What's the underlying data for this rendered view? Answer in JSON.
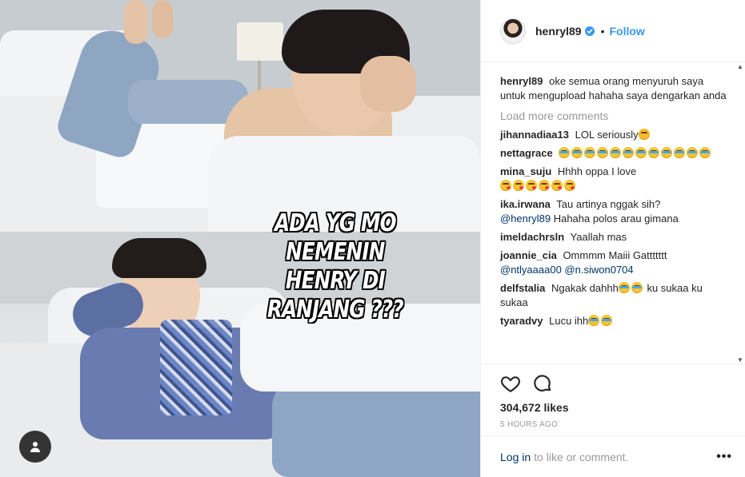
{
  "image": {
    "caption_line1": "ADA YG MO NEMENIN",
    "caption_line2": "HENRY DI RANJANG ???"
  },
  "header": {
    "username": "henryl89",
    "separator": "•",
    "follow_label": "Follow",
    "avatar_icon": "profile-avatar",
    "verified_icon": "verified-badge-icon",
    "accent_color": "#3897f0"
  },
  "caption": {
    "user": "henryl89",
    "text": "oke semua orang menyuruh saya untuk mengupload hahaha saya dengarkan anda"
  },
  "load_more": "Load more comments",
  "comments": [
    {
      "user": "jihannadiaa13",
      "text": "LOL seriously"
    },
    {
      "user": "nettagrace",
      "text": ""
    },
    {
      "user": "mina_suju",
      "text": "Hhhh oppa I love"
    },
    {
      "user": "ika.irwana",
      "text": "Tau artinya nggak sih?",
      "mention": "@henryl89",
      "text2": "Hahaha polos arau gimana"
    },
    {
      "user": "imeldachrsln",
      "text": "Yaallah mas"
    },
    {
      "user": "joannie_cia",
      "text": "Ommmm Maiii Gattttttt",
      "mention": "@ntlyaaaa00",
      "mention2": "@n.siwon0704"
    },
    {
      "user": "delfstalia",
      "text": "Ngakak dahhh",
      "text2": "ku sukaa ku sukaa"
    },
    {
      "user": "tyaradvy",
      "text": "Lucu ihh"
    }
  ],
  "actions": {
    "like_icon": "heart-icon",
    "comment_icon": "comment-icon",
    "likes": "304,672 likes",
    "timestamp": "5 HOURS AGO"
  },
  "footer": {
    "login_label": "Log in",
    "login_rest": "to like or comment.",
    "more_label": "•••"
  }
}
